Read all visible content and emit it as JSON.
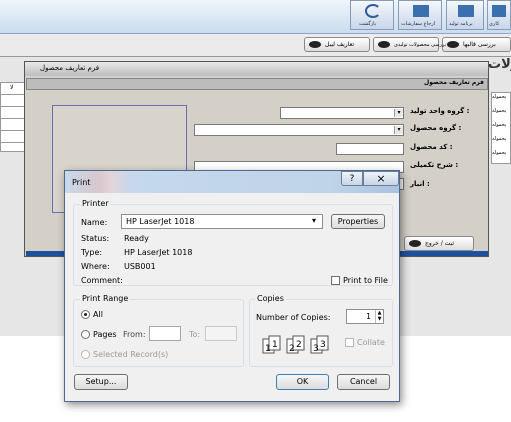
{
  "toolbar": {
    "items": [
      {
        "label": "بازگشت"
      },
      {
        "label": "ارجاع سفارشات"
      },
      {
        "label": "برنامه تولید"
      },
      {
        "label": "کاری"
      }
    ]
  },
  "subbar": {
    "buttons": [
      {
        "label": "بررسی قالبها"
      },
      {
        "label": "بررسی محصولات تولیدی"
      },
      {
        "label": "تعاریف لیبل"
      }
    ]
  },
  "background_title": "ولات",
  "form": {
    "window_title": "فرم تعاریف محصول",
    "header": "فرم تعاریف محصول",
    "fields": {
      "unit_group": "گروه واحد تولید :",
      "product_group": "گروه محصول :",
      "product_code": "کد محصول :",
      "description": "شرح تکمیلی :",
      "warehouse": "انبار :"
    },
    "exit_button": "ثبت / خروج"
  },
  "print_dialog": {
    "title": "Print",
    "help_button": "?",
    "close_button": "×",
    "printer": {
      "group_label": "Printer",
      "name_label": "Name:",
      "name_value": "HP LaserJet 1018",
      "properties_button": "Properties",
      "status_label": "Status:",
      "status_value": "Ready",
      "type_label": "Type:",
      "type_value": "HP LaserJet 1018",
      "where_label": "Where:",
      "where_value": "USB001",
      "comment_label": "Comment:",
      "print_to_file": "Print to File"
    },
    "range": {
      "group_label": "Print Range",
      "all": "All",
      "pages": "Pages",
      "from_label": "From:",
      "to_label": "To:",
      "selected": "Selected Record(s)"
    },
    "copies": {
      "group_label": "Copies",
      "number_label": "Number of Copies:",
      "number_value": "1",
      "collate": "Collate"
    },
    "setup_button": "Setup...",
    "ok_button": "OK",
    "cancel_button": "Cancel"
  },
  "side_rows": [
    "لا",
    "یحموله",
    "یحموله",
    "یحموله",
    "یحموله",
    "یحموله"
  ]
}
